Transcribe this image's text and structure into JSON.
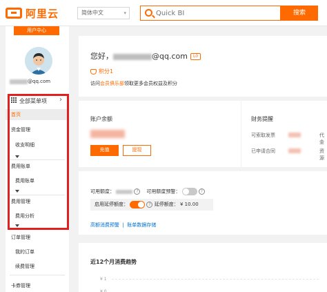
{
  "header": {
    "logo_text": "阿里云",
    "language": "简体中文",
    "search_placeholder": "Quick BI",
    "search_button": "搜索",
    "accent_color": "#ff6a00"
  },
  "sidebar": {
    "user_center_tab": "用户中心",
    "email_suffix": "@qq.com",
    "all_menu_label": "全部菜单项",
    "items": [
      {
        "label": "首页",
        "active": true
      },
      {
        "label": "资金管理"
      },
      {
        "label": "收支明细"
      },
      {
        "label": "费用账单"
      },
      {
        "label": "费用账单"
      },
      {
        "label": "费用管理"
      },
      {
        "label": "费用分析"
      },
      {
        "label": "订单管理"
      },
      {
        "label": "我的订单"
      },
      {
        "label": "续费管理"
      },
      {
        "label": "卡券管理"
      }
    ]
  },
  "profile": {
    "greeting_prefix": "您好，",
    "email_suffix": "@qq.com",
    "level": "L0",
    "points_label": "积分1",
    "visit_text_pre": "访问",
    "visit_link": "会员俱乐部",
    "visit_text_post": "领取更多会员权益及积分"
  },
  "balance": {
    "title": "账户余额",
    "recharge_button": "充值",
    "withdraw_button": "提现"
  },
  "finance": {
    "title": "财务提醒",
    "rows": [
      {
        "label": "可索取发票",
        "right": "代金"
      },
      {
        "label": "已申请合同",
        "right": "资源"
      }
    ]
  },
  "credit": {
    "available_label": "可用额度：",
    "alert_label": "可用额度预警：",
    "defer_label": "启用延停额度：",
    "defer_amount_label": "延停额度：",
    "defer_amount": "¥ 10.00",
    "link_1": "高额消费预警",
    "link_2": "账单数据存储"
  },
  "trend": {
    "title": "近12个月消费趋势",
    "y_tick": "¥ 1",
    "y_tick_2": "¥ 0"
  }
}
